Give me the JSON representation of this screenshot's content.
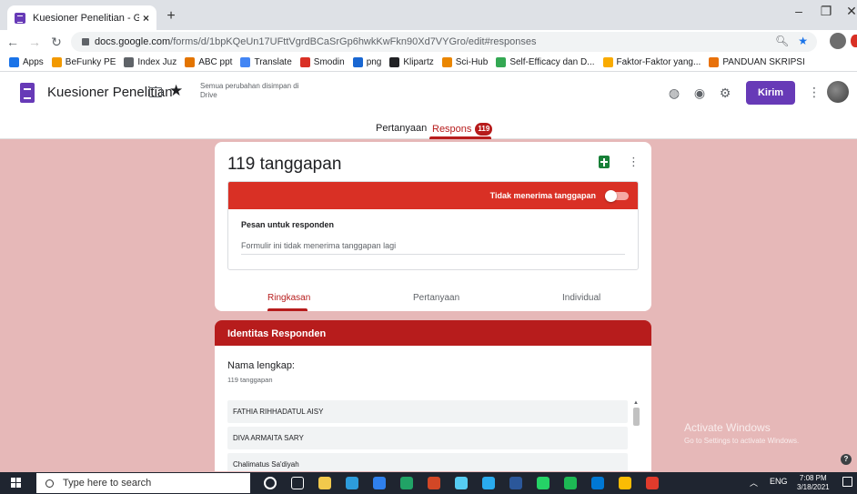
{
  "browser": {
    "tab_title": "Kuesioner Penelitian - Google Fo",
    "url_host": "docs.google.com",
    "url_path": "/forms/d/1bpKQeUn17UFttVgrdBCaSrGp6hwkKwFkn90Xd7VYGro/edit#responses",
    "bookmarks": [
      {
        "label": "Apps",
        "color": "#1a73e8"
      },
      {
        "label": "BeFunky PE",
        "color": "#f29900"
      },
      {
        "label": "Index Juz",
        "color": "#5f6368"
      },
      {
        "label": "ABC ppt",
        "color": "#e37400"
      },
      {
        "label": "Translate",
        "color": "#4285f4"
      },
      {
        "label": "Smodin",
        "color": "#d93025"
      },
      {
        "label": "png",
        "color": "#1967d2"
      },
      {
        "label": "Klipartz",
        "color": "#202124"
      },
      {
        "label": "Sci-Hub",
        "color": "#ea8600"
      },
      {
        "label": "Self-Efficacy dan D...",
        "color": "#34a853"
      },
      {
        "label": "Faktor-Faktor yang...",
        "color": "#f9ab00"
      },
      {
        "label": "PANDUAN SKRIPSI",
        "color": "#e8710a"
      }
    ]
  },
  "form_header": {
    "title": "Kuesioner Penelitian",
    "save_status": "Semua perubahan disimpan di Drive",
    "send_label": "Kirim",
    "tab_questions": "Pertanyaan",
    "tab_responses": "Respons",
    "responses_badge": "119"
  },
  "summary": {
    "count_text": "119 tanggapan",
    "not_accepting_label": "Tidak menerima tanggapan",
    "message_label": "Pesan untuk responden",
    "message_value": "Formulir ini tidak menerima tanggapan lagi",
    "subtabs": [
      "Ringkasan",
      "Pertanyaan",
      "Individual"
    ]
  },
  "section": {
    "title": "Identitas Responden",
    "question": "Nama lengkap:",
    "answer_count": "119 tanggapan",
    "answers": [
      "FATHIA RIHHADATUL AISY",
      "DIVA ARMAITA SARY",
      "Chalimatus Sa'diyah"
    ]
  },
  "watermark": {
    "line1": "Activate Windows",
    "line2": "Go to Settings to activate Windows."
  },
  "taskbar": {
    "search_placeholder": "Type here to search",
    "language": "ENG",
    "time": "7:08 PM",
    "date": "3/18/2021",
    "apps": [
      {
        "name": "cortana",
        "color": "#ffffff"
      },
      {
        "name": "task-view",
        "color": "#ffffff"
      },
      {
        "name": "file-explorer",
        "color": "#f2c94c"
      },
      {
        "name": "store",
        "color": "#2d9cdb"
      },
      {
        "name": "mail",
        "color": "#2f80ed"
      },
      {
        "name": "excel",
        "color": "#21a366"
      },
      {
        "name": "powerpoint",
        "color": "#d24726"
      },
      {
        "name": "media",
        "color": "#56ccf2"
      },
      {
        "name": "telegram",
        "color": "#2aabee"
      },
      {
        "name": "word",
        "color": "#2b579a"
      },
      {
        "name": "whatsapp",
        "color": "#25d366"
      },
      {
        "name": "spotify",
        "color": "#1db954"
      },
      {
        "name": "edge",
        "color": "#0078d4"
      },
      {
        "name": "chrome",
        "color": "#fbbc04"
      },
      {
        "name": "acrobat",
        "color": "#e03b2c"
      }
    ]
  },
  "colors": {
    "accent_red": "#b71c1c",
    "toggle_bar": "#d93025",
    "forms_purple": "#673ab7",
    "page_bg": "#e6b8b8"
  }
}
